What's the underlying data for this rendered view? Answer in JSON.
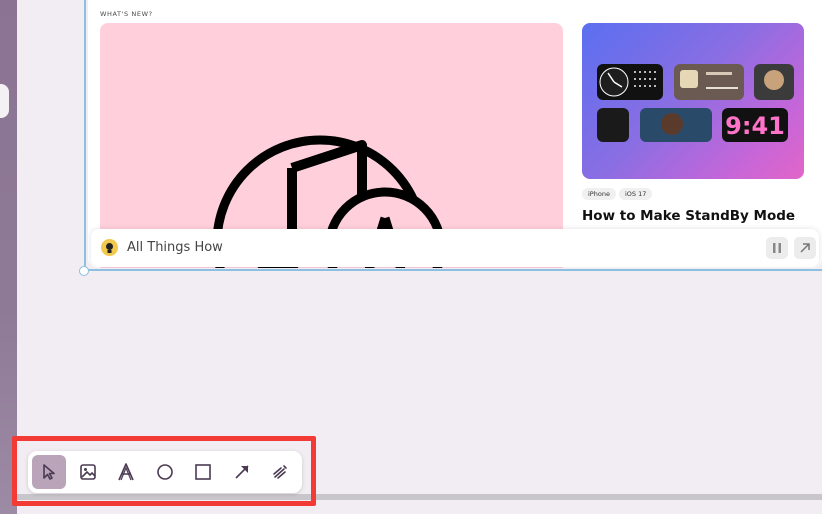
{
  "colors": {
    "accent": "#4a3a52",
    "selection": "#8cbfe0",
    "highlight": "#f23b34",
    "hero_bg": "#ffd0dc"
  },
  "card": {
    "section_label": "WHAT'S NEW?",
    "tags": [
      "iPhone",
      "iOS 17"
    ],
    "article_title": "How to Make StandBy Mode",
    "thumb_clock": "9:41",
    "site": {
      "name": "All Things How",
      "pause_icon": "pause-icon",
      "open_icon": "arrow-up-right-icon"
    }
  },
  "toolbar": {
    "tools": [
      {
        "name": "select-tool",
        "icon": "cursor-icon",
        "active": true
      },
      {
        "name": "image-tool",
        "icon": "image-icon",
        "active": false
      },
      {
        "name": "text-tool",
        "icon": "text-icon",
        "active": false
      },
      {
        "name": "ellipse-tool",
        "icon": "circle-icon",
        "active": false
      },
      {
        "name": "rectangle-tool",
        "icon": "square-icon",
        "active": false
      },
      {
        "name": "arrow-tool",
        "icon": "arrow-icon",
        "active": false
      },
      {
        "name": "draw-tool",
        "icon": "scribble-icon",
        "active": false
      }
    ]
  }
}
